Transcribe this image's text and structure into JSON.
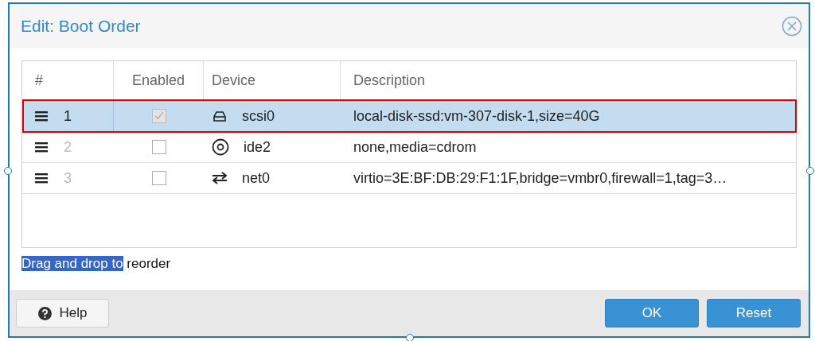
{
  "window": {
    "title": "Edit: Boot Order"
  },
  "table": {
    "columns": [
      "#",
      "Enabled",
      "Device",
      "Description"
    ],
    "rows": [
      {
        "number": "1",
        "enabled": true,
        "selected": true,
        "highlighted": true,
        "kind": "disk",
        "device": "scsi0",
        "description": "local-disk-ssd:vm-307-disk-1,size=40G"
      },
      {
        "number": "2",
        "enabled": false,
        "selected": false,
        "highlighted": false,
        "kind": "cdrom",
        "device": "ide2",
        "description": "none,media=cdrom"
      },
      {
        "number": "3",
        "enabled": false,
        "selected": false,
        "highlighted": false,
        "kind": "network",
        "device": "net0",
        "description": "virtio=3E:BF:DB:29:F1:1F,bridge=vmbr0,firewall=1,tag=3…"
      }
    ]
  },
  "hint": {
    "selected_text": "Drag and drop to",
    "text": "reorder"
  },
  "buttons": {
    "help": "Help",
    "ok": "OK",
    "reset": "Reset"
  }
}
